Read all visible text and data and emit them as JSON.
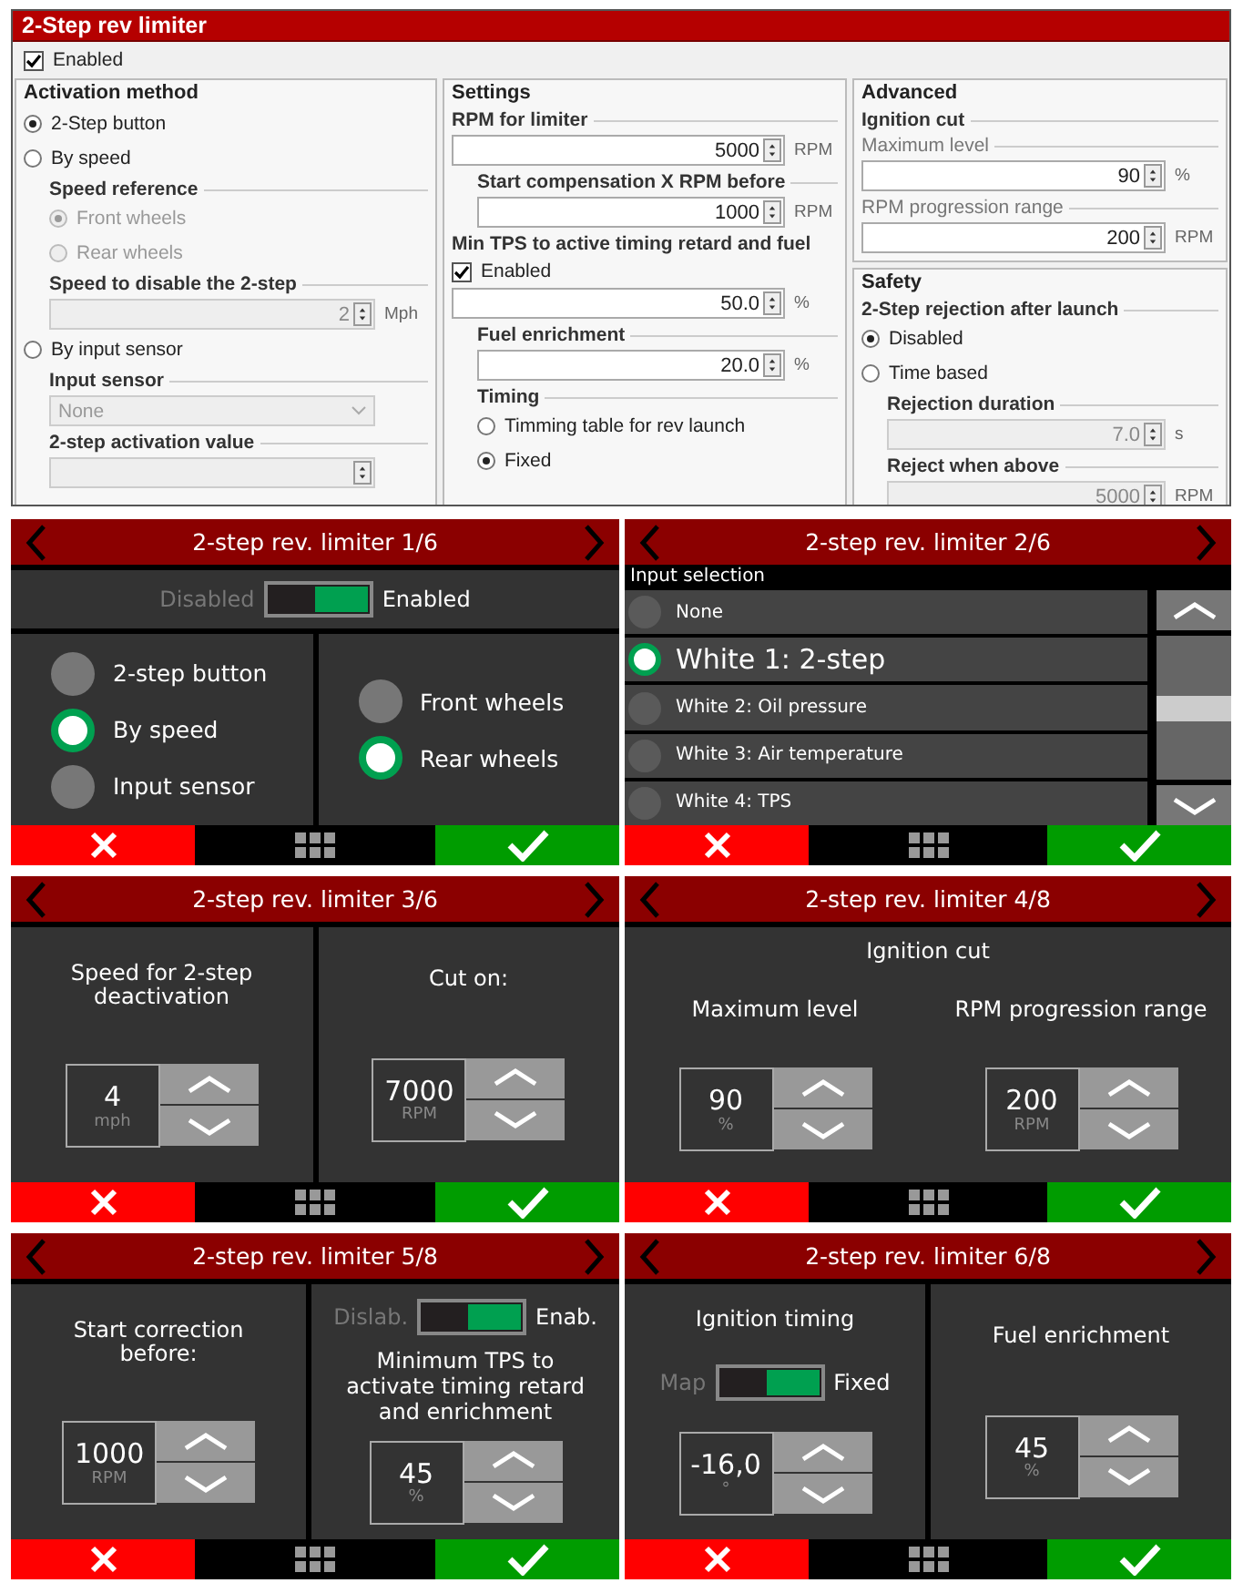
{
  "app_window": {
    "title": "2-Step rev limiter",
    "enabled": {
      "label": "Enabled",
      "checked": true
    },
    "columns": [
      {
        "sections": [
          {
            "title": "Activation method",
            "items": [
              {
                "kind": "radio",
                "label": "2-Step button",
                "selected": true
              },
              {
                "kind": "radio",
                "label": "By speed",
                "selected": false
              },
              {
                "kind": "group",
                "title": "Speed reference",
                "indented": true,
                "items": [
                  {
                    "kind": "radio",
                    "label": "Front wheels",
                    "selected": true,
                    "disabled": true
                  },
                  {
                    "kind": "radio",
                    "label": "Rear wheels",
                    "selected": false,
                    "disabled": true
                  }
                ]
              },
              {
                "kind": "group",
                "title": "Speed to disable the 2-step",
                "indented": true,
                "items": [
                  {
                    "kind": "field",
                    "value": "2",
                    "unit": "Mph",
                    "disabled": true
                  }
                ]
              },
              {
                "kind": "radio",
                "label": "By input sensor",
                "selected": false
              },
              {
                "kind": "group",
                "title": "Input sensor",
                "indented": true,
                "items": [
                  {
                    "kind": "select",
                    "value": "None",
                    "disabled": true
                  }
                ]
              },
              {
                "kind": "group",
                "title": "2-step activation value",
                "indented": true,
                "items": [
                  {
                    "kind": "field",
                    "disabled": true
                  }
                ]
              }
            ]
          }
        ]
      },
      {
        "sections": [
          {
            "title": "Settings",
            "items": [
              {
                "kind": "group",
                "title": "RPM for limiter",
                "items": [
                  {
                    "kind": "field",
                    "value": "5000",
                    "unit": "RPM"
                  }
                ]
              },
              {
                "kind": "group",
                "title": "Start compensation X RPM before",
                "indented": true,
                "items": [
                  {
                    "kind": "field",
                    "value": "1000",
                    "unit": "RPM"
                  }
                ]
              },
              {
                "kind": "heading",
                "text": "Min TPS to active timing retard and fuel"
              },
              {
                "kind": "checkbox",
                "label": "Enabled",
                "checked": true
              },
              {
                "kind": "field",
                "value": "50.0",
                "unit": "%"
              },
              {
                "kind": "group",
                "title": "Fuel enrichment",
                "indented": true,
                "items": [
                  {
                    "kind": "field",
                    "value": "20.0",
                    "unit": "%"
                  }
                ]
              },
              {
                "kind": "group",
                "title": "Timing",
                "indented": true,
                "items": [
                  {
                    "kind": "radio",
                    "label": "Timming table for rev launch",
                    "selected": false
                  },
                  {
                    "kind": "radio",
                    "label": "Fixed",
                    "selected": true
                  }
                ]
              }
            ]
          }
        ]
      },
      {
        "sections": [
          {
            "title": "Advanced",
            "items": [
              {
                "kind": "group",
                "title": "Ignition cut",
                "items": [
                  {
                    "kind": "subgroup",
                    "title": "Maximum level",
                    "items": [
                      {
                        "kind": "field",
                        "value": "90",
                        "unit": "%"
                      }
                    ]
                  },
                  {
                    "kind": "subgroup",
                    "title": "RPM progression range",
                    "items": [
                      {
                        "kind": "field",
                        "value": "200",
                        "unit": "RPM"
                      }
                    ]
                  }
                ]
              }
            ]
          },
          {
            "title": "Safety",
            "items": [
              {
                "kind": "group",
                "title": "2-Step rejection after launch",
                "items": [
                  {
                    "kind": "radio",
                    "label": "Disabled",
                    "selected": true
                  },
                  {
                    "kind": "radio",
                    "label": "Time based",
                    "selected": false
                  },
                  {
                    "kind": "group",
                    "title": "Rejection duration",
                    "indented": true,
                    "items": [
                      {
                        "kind": "field",
                        "value": "7.0",
                        "unit": "s",
                        "disabled": true
                      }
                    ]
                  },
                  {
                    "kind": "group",
                    "title": "Reject when above",
                    "indented": true,
                    "items": [
                      {
                        "kind": "field",
                        "value": "5000",
                        "unit": "RPM",
                        "disabled": true
                      }
                    ]
                  }
                ]
              }
            ]
          }
        ]
      }
    ]
  },
  "device_screens": [
    {
      "title": "2-step rev. limiter 1/6",
      "kind": "panels",
      "toggle": {
        "off_label": "Disabled",
        "on_label": "Enabled",
        "on": true
      },
      "panels": [
        {
          "items": [
            {
              "kind": "radio",
              "label": "2-step button",
              "selected": false
            },
            {
              "kind": "radio",
              "label": "By speed",
              "selected": true
            },
            {
              "kind": "radio",
              "label": "Input sensor",
              "selected": false
            }
          ]
        },
        {
          "items": [
            {
              "kind": "radio",
              "label": "Front wheels",
              "selected": false
            },
            {
              "kind": "radio",
              "label": "Rear wheels",
              "selected": true
            }
          ]
        }
      ]
    },
    {
      "title": "2-step rev. limiter 2/6",
      "kind": "list",
      "list_label": "Input selection",
      "options": [
        {
          "label": "None",
          "selected": false
        },
        {
          "label": "White 1: 2-step",
          "selected": true
        },
        {
          "label": "White 2: Oil pressure",
          "selected": false
        },
        {
          "label": "White 3: Air temperature",
          "selected": false
        },
        {
          "label": "White 4: TPS",
          "selected": false
        }
      ]
    },
    {
      "title": "2-step rev. limiter 3/6",
      "kind": "panels",
      "panels": [
        {
          "items": [
            {
              "kind": "label",
              "text": "Speed for 2-step deactivation"
            },
            {
              "kind": "spinner",
              "value": "4",
              "unit": "mph"
            }
          ]
        },
        {
          "items": [
            {
              "kind": "label",
              "text": "Cut on:"
            },
            {
              "kind": "spinner",
              "value": "7000",
              "unit": "RPM"
            }
          ]
        }
      ]
    },
    {
      "title": "2-step rev. limiter 4/8",
      "kind": "panels",
      "heading": "Ignition cut",
      "panels": [
        {
          "items": [
            {
              "kind": "label",
              "text": "Maximum level"
            },
            {
              "kind": "spinner",
              "value": "90",
              "unit": "%"
            }
          ]
        },
        {
          "items": [
            {
              "kind": "label",
              "text": "RPM progression range"
            },
            {
              "kind": "spinner",
              "value": "200",
              "unit": "RPM"
            }
          ]
        }
      ]
    },
    {
      "title": "2-step rev. limiter 5/8",
      "kind": "panels",
      "panels": [
        {
          "items": [
            {
              "kind": "label",
              "text": "Start correction before:"
            },
            {
              "kind": "spinner",
              "value": "1000",
              "unit": "RPM"
            }
          ]
        },
        {
          "items": [
            {
              "kind": "toggle",
              "off_label": "Dislab.",
              "on_label": "Enab.",
              "on": true
            },
            {
              "kind": "label",
              "text": "Minimum TPS to activate timing retard and enrichment"
            },
            {
              "kind": "spinner",
              "value": "45",
              "unit": "%"
            }
          ]
        }
      ]
    },
    {
      "title": "2-step rev. limiter 6/8",
      "kind": "panels",
      "panels": [
        {
          "items": [
            {
              "kind": "label",
              "text": "Ignition timing"
            },
            {
              "kind": "toggle",
              "off_label": "Map",
              "on_label": "Fixed",
              "on": true
            },
            {
              "kind": "spinner",
              "value": "-16,0",
              "unit": "°"
            }
          ]
        },
        {
          "items": [
            {
              "kind": "label",
              "text": "Fuel enrichment"
            },
            {
              "kind": "spinner",
              "value": "45",
              "unit": "%"
            }
          ]
        }
      ]
    }
  ]
}
